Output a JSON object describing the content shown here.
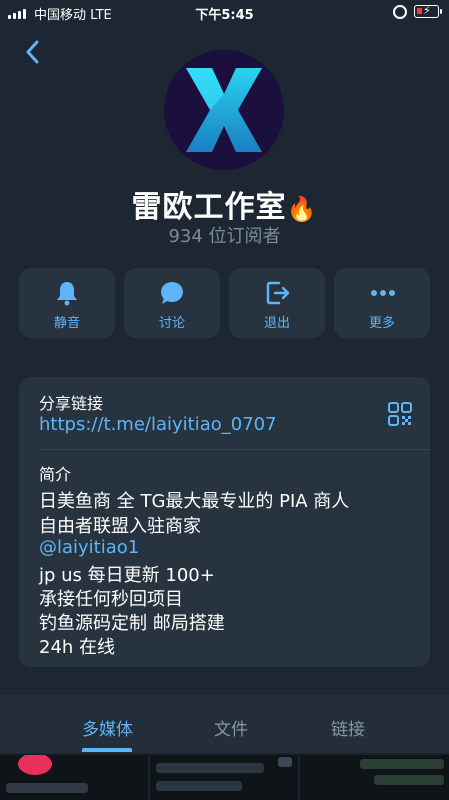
{
  "status_bar": {
    "carrier": "中国移动  LTE",
    "time": "下午5:45"
  },
  "profile": {
    "title": "雷欧工作室",
    "title_emoji": "🔥",
    "subscribers": "934 位订阅者"
  },
  "actions": [
    {
      "label": "静音",
      "icon": "bell-icon"
    },
    {
      "label": "讨论",
      "icon": "chat-bubble-icon"
    },
    {
      "label": "退出",
      "icon": "leave-icon"
    },
    {
      "label": "更多",
      "icon": "more-icon"
    }
  ],
  "info": {
    "share_label": "分享链接",
    "share_url": "https://t.me/laiyitiao_0707",
    "bio_label": "简介",
    "bio_lines": [
      "日美鱼商 全 TG最大最专业的 PIA 商人",
      "自由者联盟入驻商家",
      "@laiyitiao1",
      " jp us 每日更新 100+",
      "承接任何秒回项目",
      "钓鱼源码定制 邮局搭建",
      "24h 在线"
    ]
  },
  "tabs": [
    {
      "label": "多媒体",
      "active": true
    },
    {
      "label": "文件",
      "active": false
    },
    {
      "label": "链接",
      "active": false
    }
  ],
  "colors": {
    "background": "#1d2733",
    "card": "#27333f",
    "accent": "#5eb5f7",
    "muted": "#7d8b99"
  }
}
